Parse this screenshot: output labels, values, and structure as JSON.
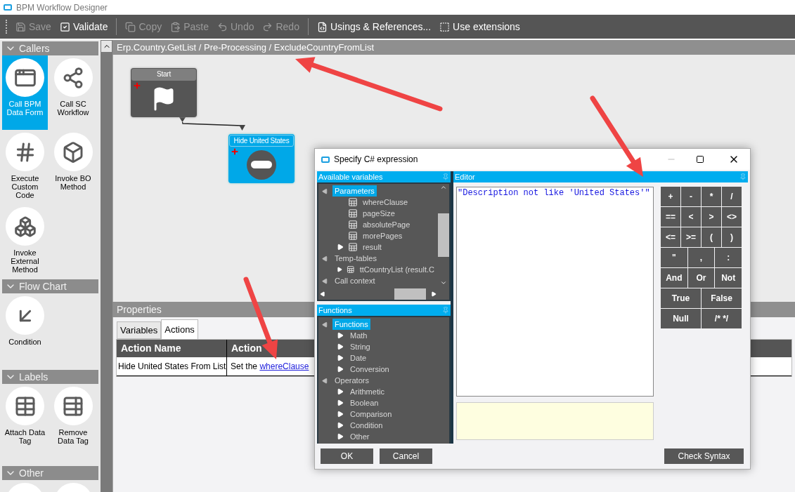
{
  "window": {
    "title": "BPM Workflow Designer"
  },
  "toolbar": [
    {
      "label": "Save",
      "disabled": true
    },
    {
      "label": "Validate",
      "disabled": false
    },
    {
      "label": "Copy",
      "disabled": true
    },
    {
      "label": "Paste",
      "disabled": true
    },
    {
      "label": "Undo",
      "disabled": true
    },
    {
      "label": "Redo",
      "disabled": true
    },
    {
      "label": "Usings & References...",
      "disabled": false
    },
    {
      "label": "Use extensions",
      "disabled": false
    }
  ],
  "sidebar": {
    "sections": [
      {
        "title": "Callers",
        "expanded": true,
        "items": [
          {
            "label": "Call BPM Data Form",
            "selected": true
          },
          {
            "label": "Call SC Workflow",
            "selected": false
          },
          {
            "label": "Execute Custom Code",
            "selected": false
          },
          {
            "label": "Invoke BO Method",
            "selected": false
          },
          {
            "label": "Invoke External Method",
            "selected": false
          }
        ]
      },
      {
        "title": "Flow Chart",
        "expanded": true,
        "items": [
          {
            "label": "Condition",
            "selected": false
          }
        ]
      },
      {
        "title": "Labels",
        "expanded": true,
        "items": [
          {
            "label": "Attach Data Tag",
            "selected": false
          },
          {
            "label": "Remove Data Tag",
            "selected": false
          }
        ]
      },
      {
        "title": "Other",
        "expanded": true,
        "items": [
          {
            "selected": false
          },
          {
            "selected": false
          }
        ]
      }
    ]
  },
  "breadcrumb": "Erp.Country.GetList / Pre-Processing / ExcludeCountryFromList",
  "nodes": [
    {
      "title": "Start",
      "kind": "start",
      "selected": false
    },
    {
      "title": "Hide United States",
      "kind": "action",
      "selected": true
    }
  ],
  "properties": {
    "title": "Properties",
    "tabs": [
      {
        "label": "Variables",
        "selected": false
      },
      {
        "label": "Actions",
        "selected": true
      }
    ],
    "table": {
      "columns": [
        "Action Name",
        "Action"
      ],
      "rows": [
        {
          "action_name": "Hide United States From List",
          "action_text": "Set the ",
          "action_link": "whereClause"
        }
      ]
    }
  },
  "dialog": {
    "title": "Specify C# expression",
    "variables": {
      "title": "Available variables",
      "tree": [
        {
          "label": "Parameters",
          "kind": "folder",
          "expanded": true,
          "selected": true,
          "children": [
            {
              "label": "whereClause",
              "kind": "field",
              "selected": false
            },
            {
              "label": "pageSize",
              "kind": "field",
              "selected": false
            },
            {
              "label": "absolutePage",
              "kind": "field",
              "selected": false
            },
            {
              "label": "morePages",
              "kind": "field",
              "selected": false
            },
            {
              "label": "result",
              "kind": "table",
              "expanded": false,
              "selected": false
            }
          ]
        },
        {
          "label": "Temp-tables",
          "kind": "folder",
          "expanded": true,
          "selected": false,
          "children": [
            {
              "label": "ttCountryList (result.C",
              "kind": "table",
              "expanded": false,
              "selected": false
            }
          ]
        },
        {
          "label": "Call context",
          "kind": "folder",
          "expanded": true,
          "selected": false
        }
      ]
    },
    "functions": {
      "title": "Functions",
      "tree": [
        {
          "label": "Functions",
          "kind": "folder",
          "expanded": true,
          "selected": true,
          "children": [
            {
              "label": "Math",
              "kind": "folder",
              "expanded": false,
              "selected": false
            },
            {
              "label": "String",
              "kind": "folder",
              "expanded": false,
              "selected": false
            },
            {
              "label": "Date",
              "kind": "folder",
              "expanded": false,
              "selected": false
            },
            {
              "label": "Conversion",
              "kind": "folder",
              "expanded": false,
              "selected": false
            }
          ]
        },
        {
          "label": "Operators",
          "kind": "folder",
          "expanded": true,
          "selected": false,
          "children": [
            {
              "label": "Arithmetic",
              "kind": "folder",
              "expanded": false,
              "selected": false
            },
            {
              "label": "Boolean",
              "kind": "folder",
              "expanded": false,
              "selected": false
            },
            {
              "label": "Comparison",
              "kind": "folder",
              "expanded": false,
              "selected": false
            },
            {
              "label": "Condition",
              "kind": "folder",
              "expanded": false,
              "selected": false
            },
            {
              "label": "Other",
              "kind": "folder",
              "expanded": false,
              "selected": false
            }
          ]
        }
      ]
    },
    "editor": {
      "title": "Editor",
      "value": "\"Description not like 'United States'\""
    },
    "keypad": [
      [
        "+",
        "-",
        "*",
        "/"
      ],
      [
        "==",
        "<",
        ">",
        "<>"
      ],
      [
        "<=",
        ">=",
        "(",
        ")"
      ],
      [
        "\"",
        ",",
        ":"
      ],
      [
        "And",
        "Or",
        "Not"
      ],
      [
        "True",
        "False"
      ],
      [
        "Null",
        "/* */"
      ]
    ],
    "buttons": [
      "OK",
      "Cancel"
    ],
    "check_button": "Check Syntax"
  }
}
